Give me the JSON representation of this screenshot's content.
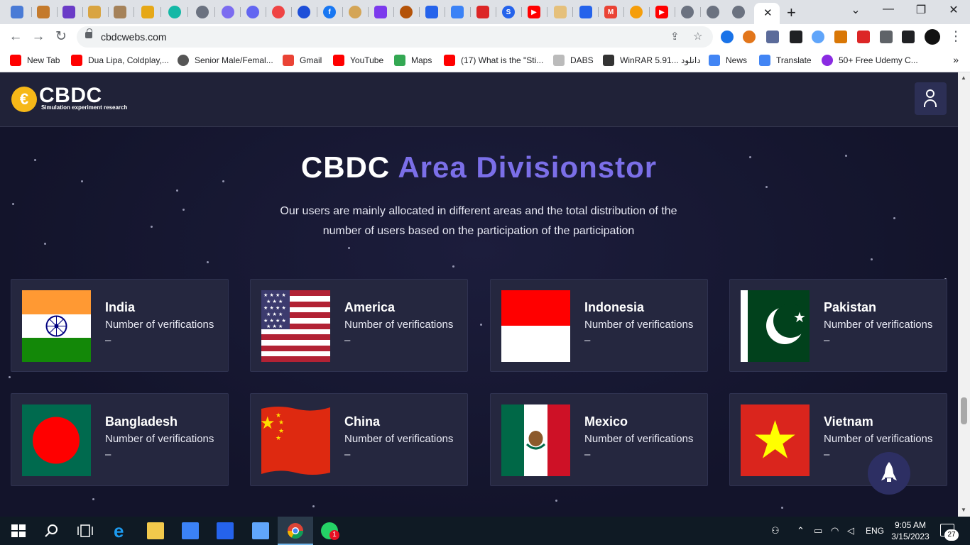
{
  "browser": {
    "tab_close": "✕",
    "new_tab": "+",
    "window_controls": {
      "dropdown": "⌄",
      "minimize": "—",
      "restore": "❐",
      "close": "✕"
    },
    "url": "cbdcwebs.com",
    "bookmarks": [
      {
        "label": "New Tab",
        "color": "#ff0000"
      },
      {
        "label": "Dua Lipa, Coldplay,...",
        "color": "#ff0000"
      },
      {
        "label": "Senior Male/Femal...",
        "color": "#555555"
      },
      {
        "label": "Gmail",
        "color": "#ea4335"
      },
      {
        "label": "YouTube",
        "color": "#ff0000"
      },
      {
        "label": "Maps",
        "color": "#34a853"
      },
      {
        "label": "(17) What is the \"Sti...",
        "color": "#ff0000"
      },
      {
        "label": "DABS",
        "color": "#777777"
      },
      {
        "label": "WinRAR 5.91... دانلود",
        "color": "#333333"
      },
      {
        "label": "News",
        "color": "#4285f4"
      },
      {
        "label": "Translate",
        "color": "#4285f4"
      },
      {
        "label": "50+ Free Udemy C...",
        "color": "#8a2be2"
      }
    ],
    "bookmarks_more": "»"
  },
  "site": {
    "logo_text": "CBDC",
    "logo_symbol": "€",
    "logo_subtitle": "Simulation experiment research",
    "title_main": "CBDC",
    "title_accent": "Area Divisionstor",
    "description": "Our users are mainly allocated in different areas and the total distribution of the number of users based on the participation of the participation",
    "accent_color": "#7b6fe8",
    "countries": [
      {
        "name": "India",
        "label": "Number of verifications",
        "value": "–"
      },
      {
        "name": "America",
        "label": "Number of verifications",
        "value": "–"
      },
      {
        "name": "Indonesia",
        "label": "Number of verifications",
        "value": "–"
      },
      {
        "name": "Pakistan",
        "label": "Number of verifications",
        "value": "–"
      },
      {
        "name": "Bangladesh",
        "label": "Number of verifications",
        "value": "–"
      },
      {
        "name": "China",
        "label": "Number of verifications",
        "value": "–"
      },
      {
        "name": "Mexico",
        "label": "Number of verifications",
        "value": "–"
      },
      {
        "name": "Vietnam",
        "label": "Number of verifications",
        "value": "–"
      }
    ]
  },
  "taskbar": {
    "language": "ENG",
    "time": "9:05 AM",
    "date": "3/15/2023",
    "notification_count": "27",
    "whatsapp_badge": "1"
  }
}
